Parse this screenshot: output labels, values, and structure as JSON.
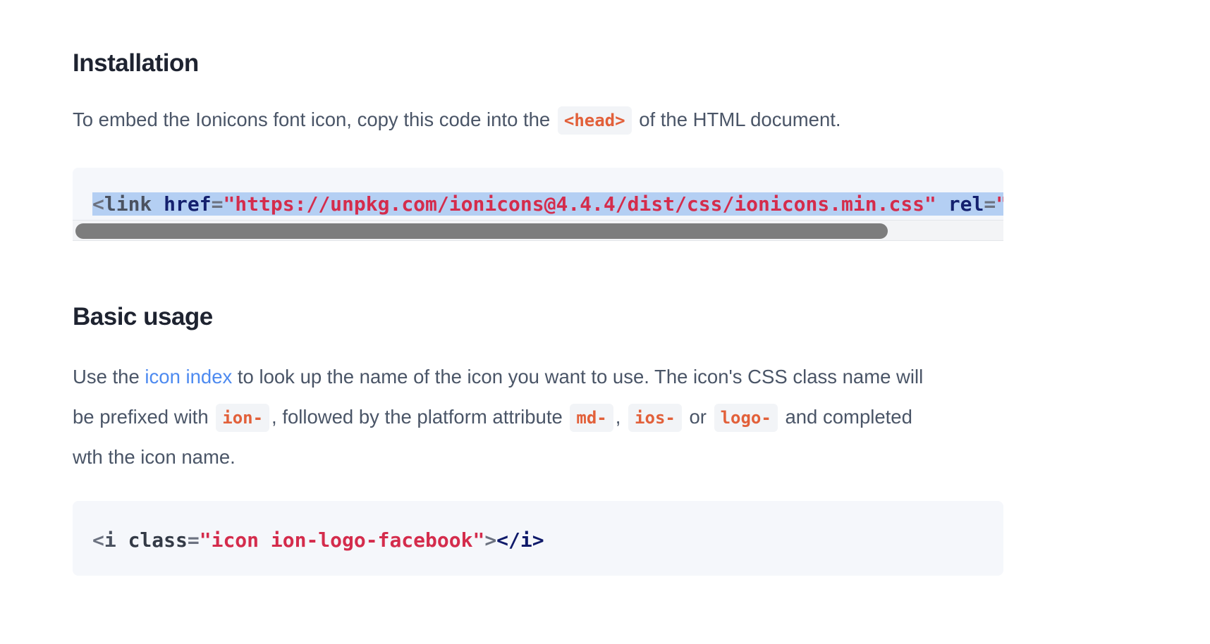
{
  "installation": {
    "heading": "Installation",
    "text_before": "To embed the Ionicons font icon, copy this code into the",
    "inline_code": "<head>",
    "text_after": "of the HTML document.",
    "code": {
      "open": "<",
      "tag": "link",
      "attr1": "href",
      "eq1": "=",
      "val1": "\"https://unpkg.com/ionicons@4.4.4/dist/css/ionicons.min.css\"",
      "attr2": "rel",
      "eq2": "=",
      "val2_partial": "\"s"
    }
  },
  "basic_usage": {
    "heading": "Basic usage",
    "line1_before": "Use the",
    "link_text": "icon index",
    "line1_after": "to look up the name of the icon you want to use. The icon's CSS class name will",
    "line2_a": "be prefixed with",
    "code_ion": "ion-",
    "line2_b": ", followed by the platform attribute",
    "code_md": "md-",
    "line2_c": ",",
    "code_ios": "ios-",
    "line2_d": "or",
    "code_logo": "logo-",
    "line2_e": "and completed",
    "line3": "wth the icon name.",
    "code": {
      "open": "<",
      "tag": "i",
      "attr": "class",
      "eq": "=",
      "val": "\"icon ion-logo-facebook\"",
      "gt": ">",
      "close": "</i>"
    }
  }
}
